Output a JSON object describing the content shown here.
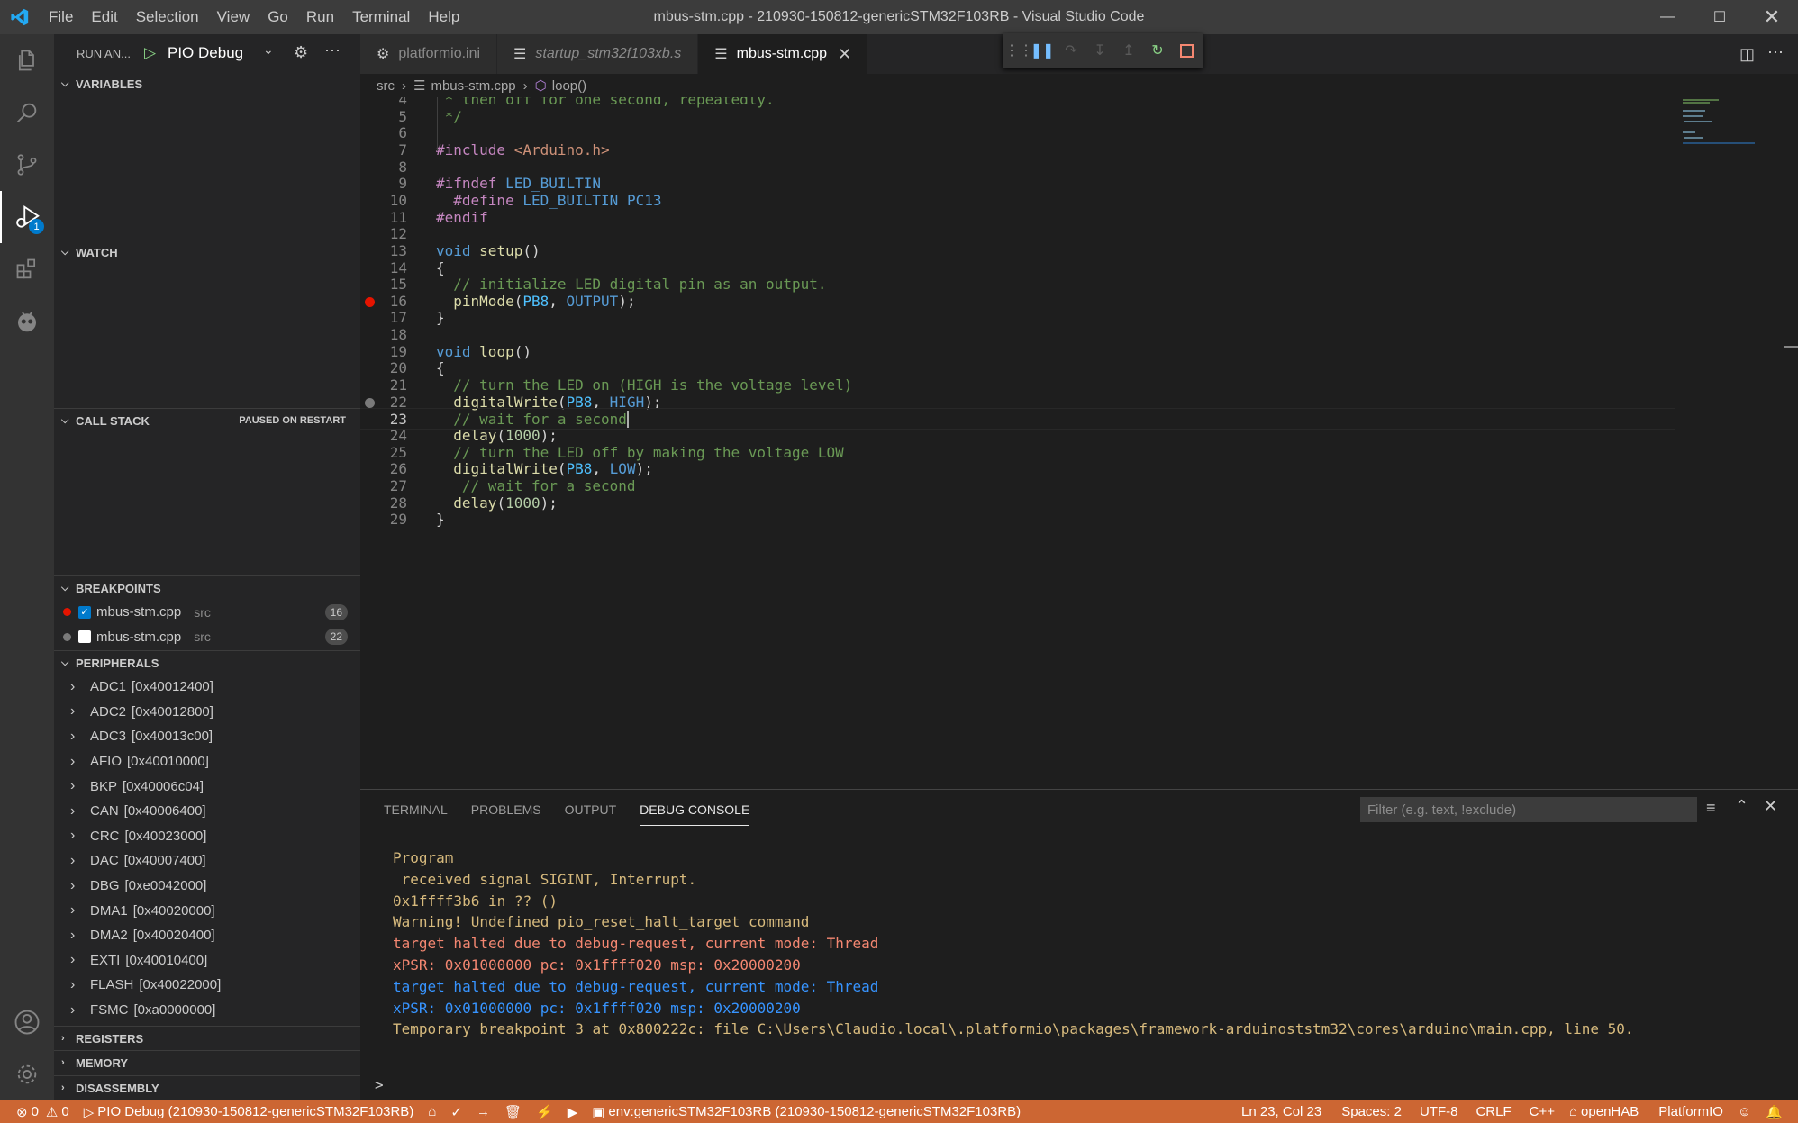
{
  "window": {
    "title": "mbus-stm.cpp - 210930-150812-genericSTM32F103RB - Visual Studio Code",
    "menu": [
      "File",
      "Edit",
      "Selection",
      "View",
      "Go",
      "Run",
      "Terminal",
      "Help"
    ]
  },
  "sidebar": {
    "run_label": "RUN AN...",
    "config_name": "PIO Debug",
    "variables_title": "VARIABLES",
    "watch_title": "WATCH",
    "callstack_title": "CALL STACK",
    "callstack_status": "PAUSED ON RESTART",
    "breakpoints_title": "BREAKPOINTS",
    "breakpoints": [
      {
        "file": "mbus-stm.cpp",
        "dir": "src",
        "line": "16",
        "checked": true
      },
      {
        "file": "mbus-stm.cpp",
        "dir": "src",
        "line": "22",
        "checked": false
      }
    ],
    "peripherals_title": "PERIPHERALS",
    "peripherals": [
      {
        "name": "ADC1",
        "addr": "[0x40012400]"
      },
      {
        "name": "ADC2",
        "addr": "[0x40012800]"
      },
      {
        "name": "ADC3",
        "addr": "[0x40013c00]"
      },
      {
        "name": "AFIO",
        "addr": "[0x40010000]"
      },
      {
        "name": "BKP",
        "addr": "[0x40006c04]"
      },
      {
        "name": "CAN",
        "addr": "[0x40006400]"
      },
      {
        "name": "CRC",
        "addr": "[0x40023000]"
      },
      {
        "name": "DAC",
        "addr": "[0x40007400]"
      },
      {
        "name": "DBG",
        "addr": "[0xe0042000]"
      },
      {
        "name": "DMA1",
        "addr": "[0x40020000]"
      },
      {
        "name": "DMA2",
        "addr": "[0x40020400]"
      },
      {
        "name": "EXTI",
        "addr": "[0x40010400]"
      },
      {
        "name": "FLASH",
        "addr": "[0x40022000]"
      },
      {
        "name": "FSMC",
        "addr": "[0xa0000000]"
      }
    ],
    "registers_title": "REGISTERS",
    "memory_title": "MEMORY",
    "disassembly_title": "DISASSEMBLY"
  },
  "tabs": [
    {
      "label": "platformio.ini",
      "italic": false
    },
    {
      "label": "startup_stm32f103xb.s",
      "italic": true
    },
    {
      "label": "mbus-stm.cpp",
      "italic": false
    }
  ],
  "breadcrumb": {
    "folder": "src",
    "file": "mbus-stm.cpp",
    "symbol": "loop()"
  },
  "code_lines": [
    {
      "n": "4",
      "t": " * then off for one second, repeatedly.",
      "c": "comment"
    },
    {
      "n": "5",
      "t": " */",
      "c": "comment"
    },
    {
      "n": "6",
      "t": "",
      "c": "plain"
    },
    {
      "n": "7",
      "t": "#include <Arduino.h>",
      "c": "include"
    },
    {
      "n": "8",
      "t": "",
      "c": "plain"
    },
    {
      "n": "9",
      "t": "#ifndef LED_BUILTIN",
      "c": "ifndef"
    },
    {
      "n": "10",
      "t": "  #define LED_BUILTIN PC13",
      "c": "define"
    },
    {
      "n": "11",
      "t": "#endif",
      "c": "endif"
    },
    {
      "n": "12",
      "t": "",
      "c": "plain"
    },
    {
      "n": "13",
      "t": "void setup()",
      "c": "func"
    },
    {
      "n": "14",
      "t": "{",
      "c": "plain"
    },
    {
      "n": "15",
      "t": "  // initialize LED digital pin as an output.",
      "c": "comment"
    },
    {
      "n": "16",
      "t": "  pinMode(PB8, OUTPUT);",
      "c": "call2",
      "bp": "red"
    },
    {
      "n": "17",
      "t": "}",
      "c": "plain"
    },
    {
      "n": "18",
      "t": "",
      "c": "plain"
    },
    {
      "n": "19",
      "t": "void loop()",
      "c": "func"
    },
    {
      "n": "20",
      "t": "{",
      "c": "plain"
    },
    {
      "n": "21",
      "t": "  // turn the LED on (HIGH is the voltage level)",
      "c": "comment"
    },
    {
      "n": "22",
      "t": "  digitalWrite(PB8, HIGH);",
      "c": "call2",
      "bp": "grey"
    },
    {
      "n": "23",
      "t": "  // wait for a second",
      "c": "comment",
      "current": true
    },
    {
      "n": "24",
      "t": "  delay(1000);",
      "c": "call1"
    },
    {
      "n": "25",
      "t": "  // turn the LED off by making the voltage LOW",
      "c": "comment"
    },
    {
      "n": "26",
      "t": "  digitalWrite(PB8, LOW);",
      "c": "call2"
    },
    {
      "n": "27",
      "t": "   // wait for a second",
      "c": "comment"
    },
    {
      "n": "28",
      "t": "  delay(1000);",
      "c": "call1"
    },
    {
      "n": "29",
      "t": "}",
      "c": "plain"
    }
  ],
  "panel": {
    "tabs": [
      "TERMINAL",
      "PROBLEMS",
      "OUTPUT",
      "DEBUG CONSOLE"
    ],
    "filter_placeholder": "Filter (e.g. text, !exclude)",
    "console": [
      {
        "t": "Program",
        "c": "#d7ba7d"
      },
      {
        "t": " received signal SIGINT, Interrupt.",
        "c": "#d7ba7d"
      },
      {
        "t": "0x1ffff3b6 in ?? ()",
        "c": "#d7ba7d"
      },
      {
        "t": "Warning! Undefined pio_reset_halt_target command",
        "c": "#d7ba7d"
      },
      {
        "t": "target halted due to debug-request, current mode: Thread",
        "c": "#f48771"
      },
      {
        "t": "xPSR: 0x01000000 pc: 0x1ffff020 msp: 0x20000200",
        "c": "#f48771"
      },
      {
        "t": "target halted due to debug-request, current mode: Thread",
        "c": "#3794ff"
      },
      {
        "t": "xPSR: 0x01000000 pc: 0x1ffff020 msp: 0x20000200",
        "c": "#3794ff"
      },
      {
        "t": "Temporary breakpoint 3 at 0x800222c: file C:\\Users\\Claudio.local\\.platformio\\packages\\framework-arduinoststm32\\cores\\arduino\\main.cpp, line 50.",
        "c": "#d7ba7d"
      }
    ],
    "prompt": ">"
  },
  "statusbar": {
    "errors": "0",
    "warnings": "0",
    "debug_session": "PIO Debug (210930-150812-genericSTM32F103RB)",
    "env": "env:genericSTM32F103RB (210930-150812-genericSTM32F103RB)",
    "position": "Ln 23, Col 23",
    "spaces": "Spaces: 2",
    "encoding": "UTF-8",
    "eol": "CRLF",
    "language": "C++",
    "openhab": "openHAB",
    "platformio": "PlatformIO"
  },
  "colors": {
    "statusbar": "#cc6633",
    "accent": "#007acc",
    "breakpoint": "#e51400"
  },
  "icons": [
    "vscode-logo",
    "explorer-icon",
    "search-icon",
    "source-control-icon",
    "run-debug-icon",
    "extensions-icon",
    "platformio-icon",
    "account-icon",
    "settings-gear-icon"
  ]
}
